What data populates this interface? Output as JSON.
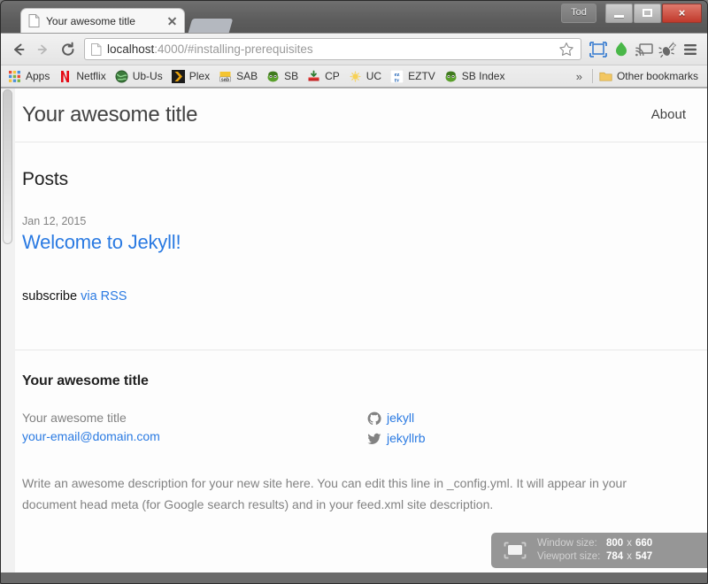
{
  "window": {
    "tab_title": "Your awesome title",
    "extension_button_label": "Tod",
    "controls": {
      "minimize": "minimize",
      "maximize": "maximize",
      "close": "×"
    }
  },
  "toolbar": {
    "back": "back-arrow",
    "forward": "forward-arrow",
    "reload": "reload-arrow",
    "url_host": "localhost",
    "url_rest": ":4000/#installing-prerequisites",
    "bookmark_star": "star-icon",
    "icons": [
      "window-resizer-icon",
      "green-drop-icon",
      "cast-icon",
      "bug-icon",
      "chrome-menu-icon"
    ]
  },
  "bookmarks": {
    "items": [
      {
        "label": "Apps",
        "icon": "apps-grid-icon"
      },
      {
        "label": "Netflix",
        "icon": "netflix-icon"
      },
      {
        "label": "Ub-Us",
        "icon": "globe-icon"
      },
      {
        "label": "Plex",
        "icon": "plex-chevron-icon"
      },
      {
        "label": "SAB",
        "icon": "sabnzbd-icon"
      },
      {
        "label": "SB",
        "icon": "sickbeard-icon"
      },
      {
        "label": "CP",
        "icon": "couchpotato-icon"
      },
      {
        "label": "UC",
        "icon": "usenet-crawler-icon"
      },
      {
        "label": "EZTV",
        "icon": "eztv-icon"
      },
      {
        "label": "SB Index",
        "icon": "sickbeard-icon"
      }
    ],
    "overflow": "»",
    "other": {
      "label": "Other bookmarks",
      "icon": "folder-icon"
    }
  },
  "page": {
    "site_title": "Your awesome title",
    "nav": [
      {
        "label": "About"
      }
    ],
    "posts_heading": "Posts",
    "posts": [
      {
        "date": "Jan 12, 2015",
        "title": "Welcome to Jekyll!"
      }
    ],
    "subscribe_text": "subscribe ",
    "subscribe_link": "via RSS"
  },
  "footer": {
    "heading": "Your awesome title",
    "contact_name": "Your awesome title",
    "contact_email": "your-email@domain.com",
    "social": [
      {
        "icon": "github-icon",
        "handle": "jekyll"
      },
      {
        "icon": "twitter-icon",
        "handle": "jekyllrb"
      }
    ],
    "description": "Write an awesome description for your new site here. You can edit this line in _config.yml. It will appear in your document head meta (for Google search results) and in your feed.xml site description."
  },
  "resizer_overlay": {
    "icon": "monitor-icon",
    "window_label": "Window size:",
    "window_value": "800",
    "window_x": "x",
    "window_value2": "660",
    "viewport_label": "Viewport size:",
    "viewport_value": "784",
    "viewport_x": "x",
    "viewport_value2": "547"
  },
  "colors": {
    "link": "#2a7ae2",
    "muted": "#828282",
    "close_button": "#c0392b"
  }
}
